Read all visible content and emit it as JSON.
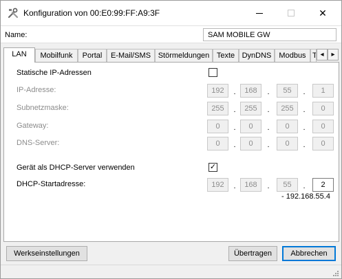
{
  "window": {
    "title": "Konfiguration von 00:E0:99:FF:A9:3F",
    "icon": "tools-icon",
    "close_glyph": "✕"
  },
  "name_row": {
    "label": "Name:",
    "value": "SAM MOBILE GW"
  },
  "tabs": [
    {
      "label": "LAN",
      "active": true
    },
    {
      "label": "Mobilfunk"
    },
    {
      "label": "Portal"
    },
    {
      "label": "E-Mail/SMS"
    },
    {
      "label": "Störmeldungen"
    },
    {
      "label": "Texte"
    },
    {
      "label": "DynDNS"
    },
    {
      "label": "Modbus"
    },
    {
      "label": "T"
    }
  ],
  "tab_scroll": {
    "left": "◂",
    "right": "▸"
  },
  "lan": {
    "static_ip_label": "Statische IP-Adressen",
    "static_ip_checked": false,
    "ip_label": "IP-Adresse:",
    "ip": [
      "192",
      "168",
      "55",
      "1"
    ],
    "subnet_label": "Subnetzmaske:",
    "subnet": [
      "255",
      "255",
      "255",
      "0"
    ],
    "gateway_label": "Gateway:",
    "gateway": [
      "0",
      "0",
      "0",
      "0"
    ],
    "dns_label": "DNS-Server:",
    "dns": [
      "0",
      "0",
      "0",
      "0"
    ],
    "dhcp_label": "Gerät als DHCP-Server verwenden",
    "dhcp_checked": true,
    "dhcp_check_glyph": "✓",
    "dhcp_start_label": "DHCP-Startadresse:",
    "dhcp_start": [
      "192",
      "168",
      "55",
      "2"
    ],
    "dhcp_end_hint": "- 192.168.55.4",
    "octet_separator": "."
  },
  "buttons": {
    "factory": "Werkseinstellungen",
    "transfer": "Übertragen",
    "cancel": "Abbrechen"
  }
}
